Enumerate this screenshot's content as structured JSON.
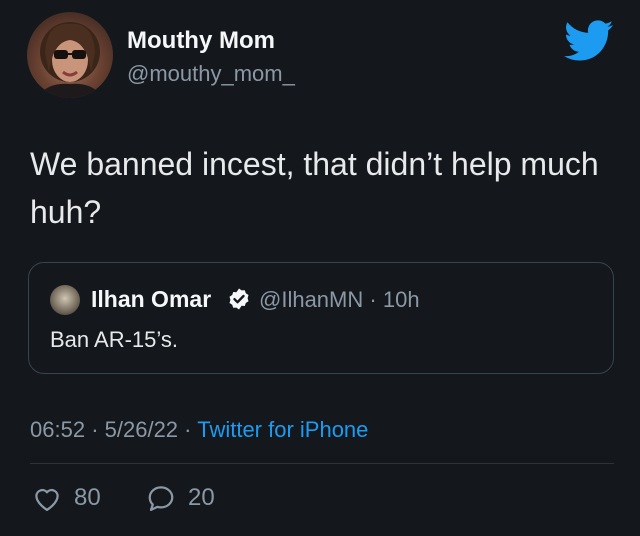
{
  "author": {
    "display_name": "Mouthy Mom",
    "handle": "@mouthy_mom_"
  },
  "tweet_text": "We banned incest, that didn’t help much huh?",
  "quoted_tweet": {
    "display_name": "Ilhan Omar",
    "verified": true,
    "handle": "@IlhanMN",
    "separator": "·",
    "age": "10h",
    "text": "Ban AR-15’s."
  },
  "meta": {
    "time": "06:52",
    "date": "5/26/22",
    "separator": "·",
    "source": "Twitter for iPhone"
  },
  "stats": {
    "likes": "80",
    "replies": "20"
  },
  "colors": {
    "background": "#14171c",
    "accent": "#1d9bf0",
    "muted": "#8b98a5"
  }
}
